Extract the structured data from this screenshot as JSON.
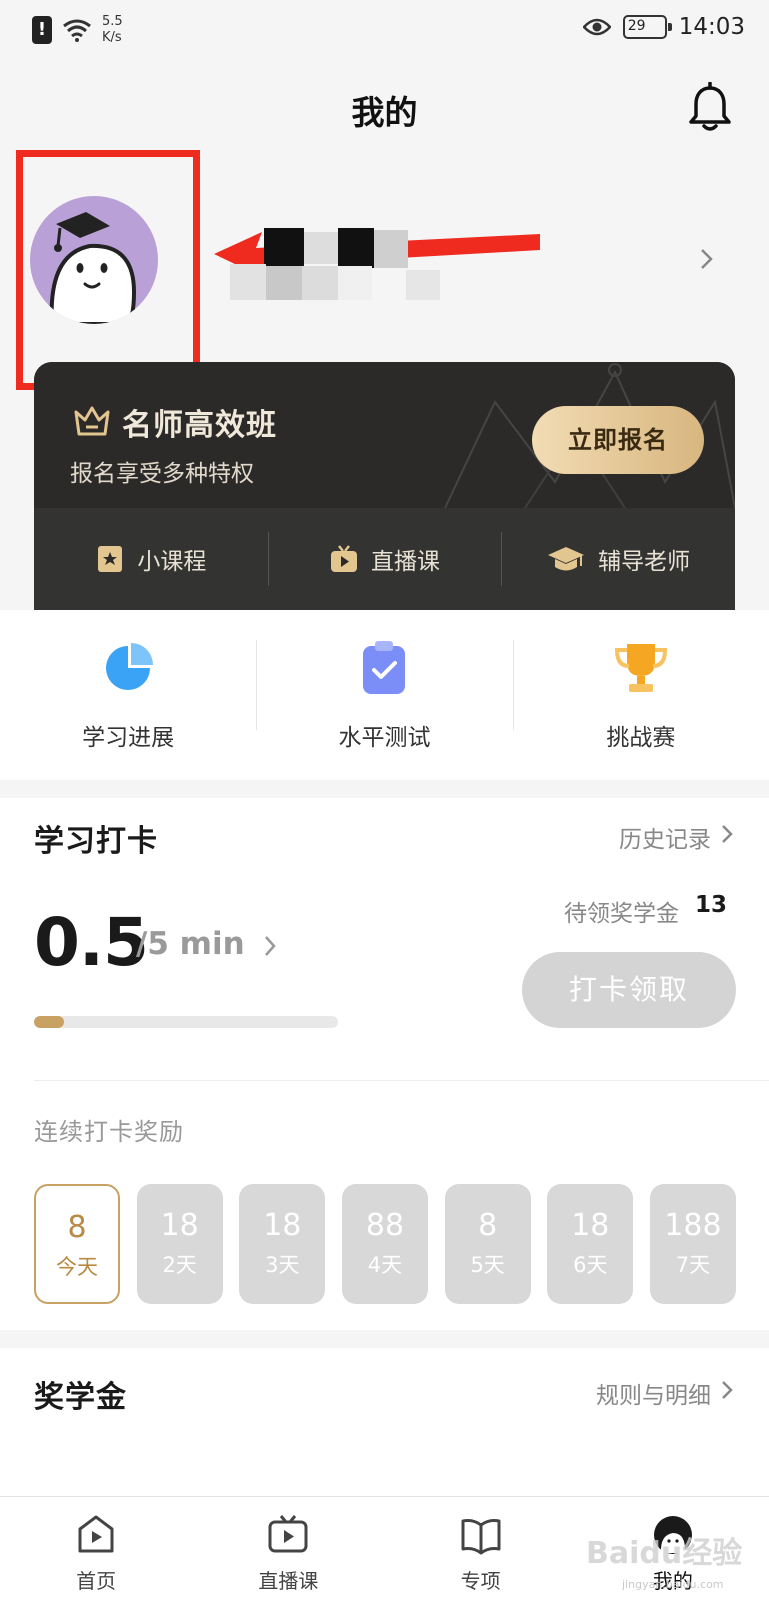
{
  "status_bar": {
    "net_speed_value": "5.5",
    "net_speed_unit": "K/s",
    "battery": "29",
    "time": "14:03"
  },
  "header": {
    "title": "我的"
  },
  "vip": {
    "title": "名师高效班",
    "subtitle": "报名享受多种特权",
    "cta": "立即报名",
    "tabs": [
      {
        "label": "小课程",
        "icon": "star-book-icon"
      },
      {
        "label": "直播课",
        "icon": "tv-play-icon"
      },
      {
        "label": "辅导老师",
        "icon": "grad-cap-icon"
      }
    ]
  },
  "quick_actions": [
    {
      "label": "学习进展",
      "icon": "pie-progress-icon",
      "color": "#3aa3f5"
    },
    {
      "label": "水平测试",
      "icon": "clipboard-check-icon",
      "color": "#6b8af5"
    },
    {
      "label": "挑战赛",
      "icon": "trophy-icon",
      "color": "#f5a623"
    }
  ],
  "checkin": {
    "title": "学习打卡",
    "history_link": "历史记录",
    "current": "0.5",
    "target": "/5 min",
    "progress_fraction": 0.1,
    "reward_label": "待领奖学金",
    "reward_count": "13",
    "button": "打卡领取",
    "streak_title": "连续打卡奖励",
    "days": [
      {
        "value": "8",
        "label": "今天",
        "active": true
      },
      {
        "value": "18",
        "label": "2天"
      },
      {
        "value": "18",
        "label": "3天"
      },
      {
        "value": "88",
        "label": "4天"
      },
      {
        "value": "8",
        "label": "5天"
      },
      {
        "value": "18",
        "label": "6天"
      },
      {
        "value": "188",
        "label": "7天"
      }
    ]
  },
  "scholarship": {
    "title": "奖学金",
    "rules_link": "规则与明细"
  },
  "tabbar": [
    {
      "label": "首页",
      "icon": "home-play-icon"
    },
    {
      "label": "直播课",
      "icon": "tv-play-icon"
    },
    {
      "label": "专项",
      "icon": "open-book-icon"
    },
    {
      "label": "我的",
      "icon": "mascot-avatar-icon",
      "active": true
    }
  ],
  "watermark": {
    "main": "Baidu经验",
    "sub": "jingyan.baidu.com"
  },
  "colors": {
    "accent_gold": "#c9a163",
    "annotation_red": "#ef2a1f",
    "vip_bg": "#2b2a28"
  }
}
